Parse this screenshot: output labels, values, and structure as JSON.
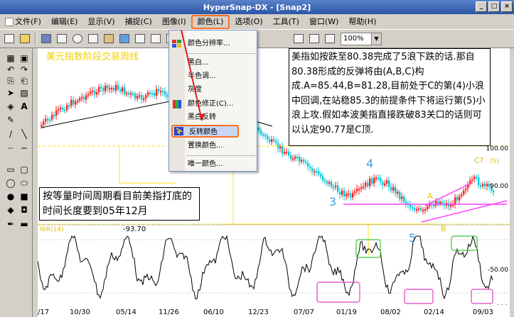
{
  "window": {
    "title": "HyperSnap-DX - [Snap2]"
  },
  "menubar": {
    "items": [
      {
        "label": "文件(F)"
      },
      {
        "label": "编辑(E)"
      },
      {
        "label": "显示(V)"
      },
      {
        "label": "捕捉(C)"
      },
      {
        "label": "图像(I)"
      },
      {
        "label": "颜色(L)"
      },
      {
        "label": "选项(O)"
      },
      {
        "label": "工具(T)"
      },
      {
        "label": "窗口(W)"
      },
      {
        "label": "帮助(H)"
      }
    ]
  },
  "toolbar": {
    "zoom_value": "100%"
  },
  "color_menu": {
    "items": [
      {
        "label": "颜色分辨率...",
        "icon": "palette-icon"
      },
      {
        "label": "黑白...",
        "icon": ""
      },
      {
        "label": "半色调...",
        "icon": ""
      },
      {
        "label": "灰度",
        "icon": ""
      },
      {
        "label": "颜色修正(C)...",
        "icon": "color-correct-icon"
      },
      {
        "label": "黑白反转",
        "icon": ""
      },
      {
        "label": "反转颜色",
        "icon": "invert-icon"
      },
      {
        "label": "置换颜色...",
        "icon": ""
      },
      {
        "label": "唯一颜色...",
        "icon": ""
      }
    ]
  },
  "chart": {
    "top_title": "美元指数阶段交易周线",
    "right_axis_labels": [
      "100.00",
      "90.00",
      "-50.00",
      "-100"
    ],
    "osc_label": "WR(14)",
    "osc_value": "-93.70",
    "x_labels": [
      "/17",
      "10/30",
      "05/14",
      "11/26",
      "06/10",
      "12/23",
      "07/07",
      "01/19",
      "08/02",
      "02/14",
      "09/03"
    ],
    "wave_labels": {
      "w3": "3",
      "w4": "4",
      "w5": "5",
      "wA": "A",
      "wB": "B",
      "wC": "C?",
      "w5b": "(5)"
    },
    "note_right": "美指如按跌至80.38完成了5浪下跌的话.那自80.38形成的反弹将由(A,B,C)构成.A=85.44,B=81.28,目前处于C的第(4)小浪中回调,在站稳85.3的前提条件下将运行第(5)小浪上攻.假如本波美指直接跌破83关口的话则可以认定90.77是C顶.",
    "note_left": "按等量时间周期看目前美指打底的时间长度要到05年12月"
  },
  "colors": {
    "titlebar": "#2c56a8",
    "highlight_border": "#ff7020",
    "up_candle": "#ff2020",
    "down_candle": "#00c8d8",
    "fib_line": "#ffe000",
    "trend_line": "#ff40ff",
    "osc_box_green": "#40c040",
    "osc_box_magenta": "#e040c0"
  }
}
